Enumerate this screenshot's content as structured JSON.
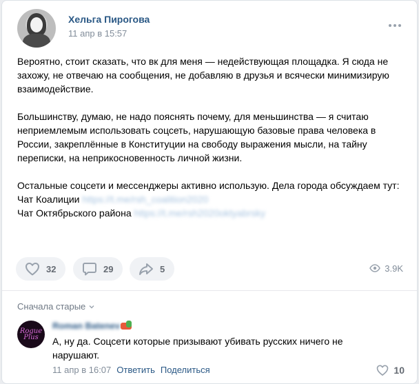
{
  "post": {
    "author": "Хельга Пирогова",
    "date": "11 апр в 15:57",
    "paragraph1": "Вероятно, стоит сказать, что вк для меня — недействующая площадка. Я сюда не захожу, не отвечаю на сообщения, не добавляю в друзья и всячески минимизирую взаимодействие.",
    "paragraph2": "Большинству, думаю, не надо пояснять почему, для меньшинства — я считаю неприемлемым использовать соцсеть, нарушающую базовые права человека в России, закреплённые в Конституции на свободу выражения мысли, на тайну переписки, на неприкосновенность личной жизни.",
    "paragraph3_line1": "Остальные соцсети и мессенджеры активно использую. Дела города обсуждаем тут:",
    "chat1_label": "Чат Коалиции",
    "chat1_link": "https://t.me/rsh_coalition2020",
    "chat2_label": "Чат Октябрьского района",
    "chat2_link": "https://t.me/rsh2020oktyabrsky"
  },
  "actions": {
    "likes": "32",
    "comments": "29",
    "shares": "5",
    "views": "3.9K"
  },
  "comments_section": {
    "sort_label": "Сначала старые"
  },
  "comment": {
    "author": "Roman Batenev",
    "avatar_text": "Rogue Plus",
    "text": "А, ну да. Соцсети которые призывают убивать русских ничего не нарушают.",
    "date": "11 апр в 16:07",
    "reply_label": "Ответить",
    "share_label": "Поделиться",
    "likes": "10"
  },
  "colors": {
    "link": "#2a5885",
    "muted": "#818c99",
    "pill_bg": "#f0f2f5"
  }
}
